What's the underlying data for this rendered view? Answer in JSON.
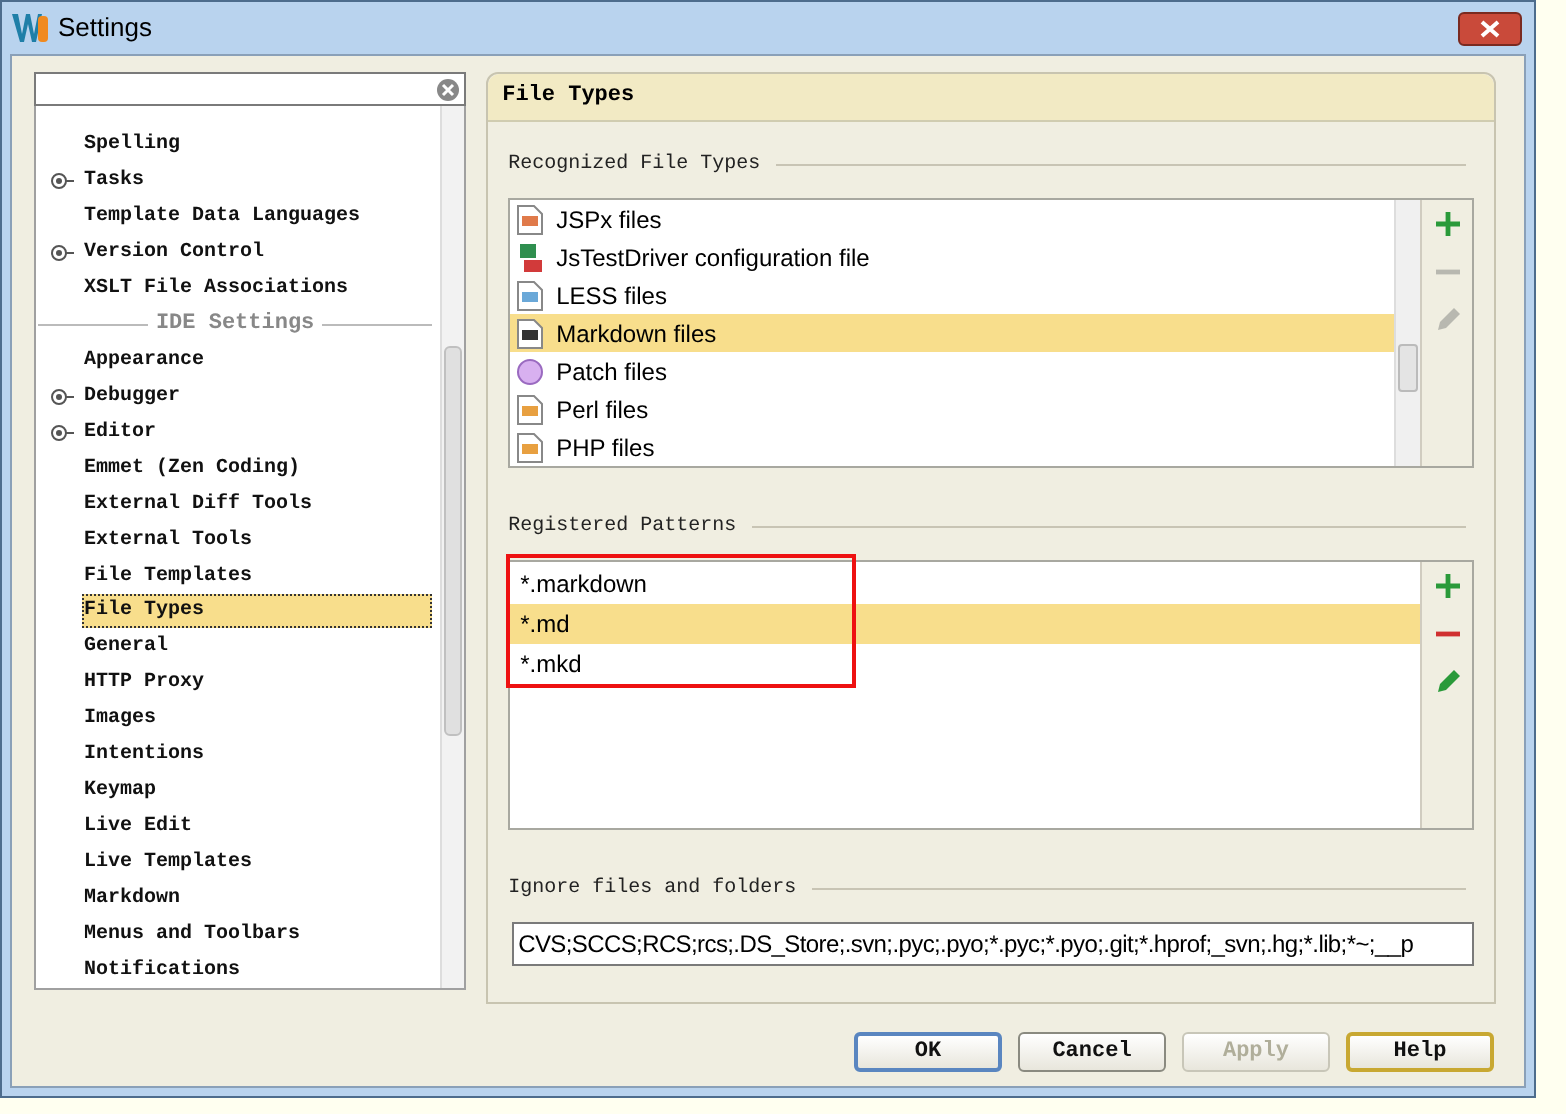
{
  "window": {
    "title": "Settings"
  },
  "tree": [
    {
      "label": "Spelling",
      "kind": "leaf",
      "selected": false
    },
    {
      "label": "Tasks",
      "kind": "node",
      "selected": false
    },
    {
      "label": "Template Data Languages",
      "kind": "leaf",
      "selected": false
    },
    {
      "label": "Version Control",
      "kind": "node",
      "selected": false
    },
    {
      "label": "XSLT File Associations",
      "kind": "leaf",
      "selected": false
    },
    {
      "label": "IDE Settings",
      "kind": "header"
    },
    {
      "label": "Appearance",
      "kind": "leaf",
      "selected": false
    },
    {
      "label": "Debugger",
      "kind": "node",
      "selected": false
    },
    {
      "label": "Editor",
      "kind": "node",
      "selected": false
    },
    {
      "label": "Emmet (Zen Coding)",
      "kind": "leaf",
      "selected": false
    },
    {
      "label": "External Diff Tools",
      "kind": "leaf",
      "selected": false
    },
    {
      "label": "External Tools",
      "kind": "leaf",
      "selected": false
    },
    {
      "label": "File Templates",
      "kind": "leaf",
      "selected": false
    },
    {
      "label": "File Types",
      "kind": "leaf",
      "selected": true
    },
    {
      "label": "General",
      "kind": "leaf",
      "selected": false
    },
    {
      "label": "HTTP Proxy",
      "kind": "leaf",
      "selected": false
    },
    {
      "label": "Images",
      "kind": "leaf",
      "selected": false
    },
    {
      "label": "Intentions",
      "kind": "leaf",
      "selected": false
    },
    {
      "label": "Keymap",
      "kind": "leaf",
      "selected": false
    },
    {
      "label": "Live Edit",
      "kind": "leaf",
      "selected": false
    },
    {
      "label": "Live Templates",
      "kind": "leaf",
      "selected": false
    },
    {
      "label": "Markdown",
      "kind": "leaf",
      "selected": false
    },
    {
      "label": "Menus and Toolbars",
      "kind": "leaf",
      "selected": false
    },
    {
      "label": "Notifications",
      "kind": "leaf",
      "selected": false
    }
  ],
  "panel": {
    "title": "File Types",
    "recognized": {
      "title": "Recognized File Types",
      "items": [
        {
          "label": "JSPx files",
          "kind": "jspx",
          "selected": false
        },
        {
          "label": "JsTestDriver configuration file",
          "kind": "jstd",
          "selected": false
        },
        {
          "label": "LESS files",
          "kind": "less",
          "selected": false
        },
        {
          "label": "Markdown files",
          "kind": "markdown",
          "selected": true
        },
        {
          "label": "Patch files",
          "kind": "patch",
          "selected": false
        },
        {
          "label": "Perl files",
          "kind": "script",
          "selected": false
        },
        {
          "label": "PHP files",
          "kind": "script",
          "selected": false
        }
      ],
      "tools": [
        {
          "kind": "add",
          "disabled": false
        },
        {
          "kind": "remove",
          "disabled": true
        },
        {
          "kind": "edit",
          "disabled": true
        }
      ]
    },
    "patterns": {
      "title": "Registered Patterns",
      "items": [
        {
          "label": "*.markdown",
          "selected": false
        },
        {
          "label": "*.md",
          "selected": true
        },
        {
          "label": "*.mkd",
          "selected": false
        }
      ],
      "tools": [
        {
          "kind": "add",
          "disabled": false
        },
        {
          "kind": "remove",
          "disabled": false
        },
        {
          "kind": "edit",
          "disabled": false
        }
      ]
    },
    "ignore": {
      "title": "Ignore files and folders",
      "value": "CVS;SCCS;RCS;rcs;.DS_Store;.svn;.pyc;.pyo;*.pyc;*.pyo;.git;*.hprof;_svn;.hg;*.lib;*~;__p"
    }
  },
  "buttons": [
    {
      "label": "OK",
      "kind": "default",
      "disabled": false
    },
    {
      "label": "Cancel",
      "kind": "normal",
      "disabled": false
    },
    {
      "label": "Apply",
      "kind": "normal",
      "disabled": true
    },
    {
      "label": "Help",
      "kind": "focused",
      "disabled": false
    }
  ]
}
